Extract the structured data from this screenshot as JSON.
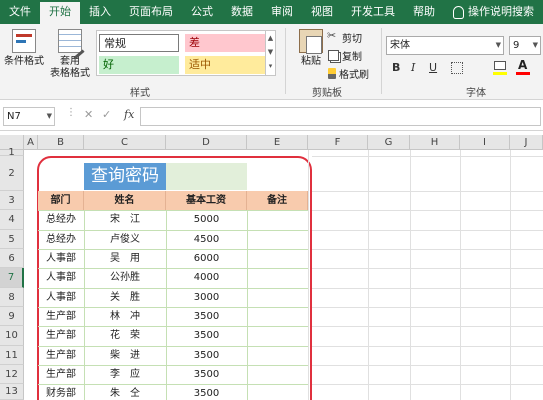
{
  "ribbon_tabs": [
    "文件",
    "开始",
    "插入",
    "页面布局",
    "公式",
    "数据",
    "审阅",
    "视图",
    "开发工具",
    "帮助"
  ],
  "active_tab": "开始",
  "help_search": "操作说明搜索",
  "ribbon": {
    "conditional_format": "条件格式",
    "table_format_line1": "套用",
    "table_format_line2": "表格格式",
    "styles": {
      "normal": "常规",
      "bad": "差",
      "good": "好",
      "neutral": "适中"
    },
    "styles_group": "样式",
    "paste": "粘贴",
    "cut": "剪切",
    "copy": "复制",
    "format_painter": "格式刷",
    "clipboard_group": "剪贴板",
    "font_name": "宋体",
    "font_size": "9",
    "bold": "B",
    "italic": "I",
    "underline": "U",
    "font_color_glyph": "A",
    "font_group": "字体"
  },
  "name_box": "N7",
  "formula_bar": {
    "fx": "fx",
    "cancel": "✕",
    "enter": "✓",
    "value": ""
  },
  "columns": [
    "A",
    "B",
    "C",
    "D",
    "E",
    "F",
    "G",
    "H",
    "I",
    "J"
  ],
  "rows": [
    "1",
    "2",
    "3",
    "4",
    "5",
    "6",
    "7",
    "8",
    "9",
    "10",
    "11",
    "12",
    "13"
  ],
  "selected_row": "7",
  "sheet": {
    "title": "查询密码",
    "headers": [
      "部门",
      "姓名",
      "基本工资",
      "备注"
    ],
    "records": [
      {
        "dept": "总经办",
        "name": "宋　江",
        "salary": "5000",
        "note": ""
      },
      {
        "dept": "总经办",
        "name": "卢俊义",
        "salary": "4500",
        "note": ""
      },
      {
        "dept": "人事部",
        "name": "吴　用",
        "salary": "6000",
        "note": ""
      },
      {
        "dept": "人事部",
        "name": "公孙胜",
        "salary": "4000",
        "note": ""
      },
      {
        "dept": "人事部",
        "name": "关　胜",
        "salary": "3000",
        "note": ""
      },
      {
        "dept": "生产部",
        "name": "林　冲",
        "salary": "3500",
        "note": ""
      },
      {
        "dept": "生产部",
        "name": "花　荣",
        "salary": "3500",
        "note": ""
      },
      {
        "dept": "生产部",
        "name": "柴　进",
        "salary": "3500",
        "note": ""
      },
      {
        "dept": "生产部",
        "name": "李　应",
        "salary": "3500",
        "note": ""
      },
      {
        "dept": "财务部",
        "name": "朱　仝",
        "salary": "3500",
        "note": ""
      }
    ]
  },
  "colors": {
    "excel_green": "#217346",
    "title_fill": "#5b9bd5",
    "header_fill": "#f8cbad",
    "border_green": "#c5e0b4",
    "frame_red": "#e0303e"
  }
}
